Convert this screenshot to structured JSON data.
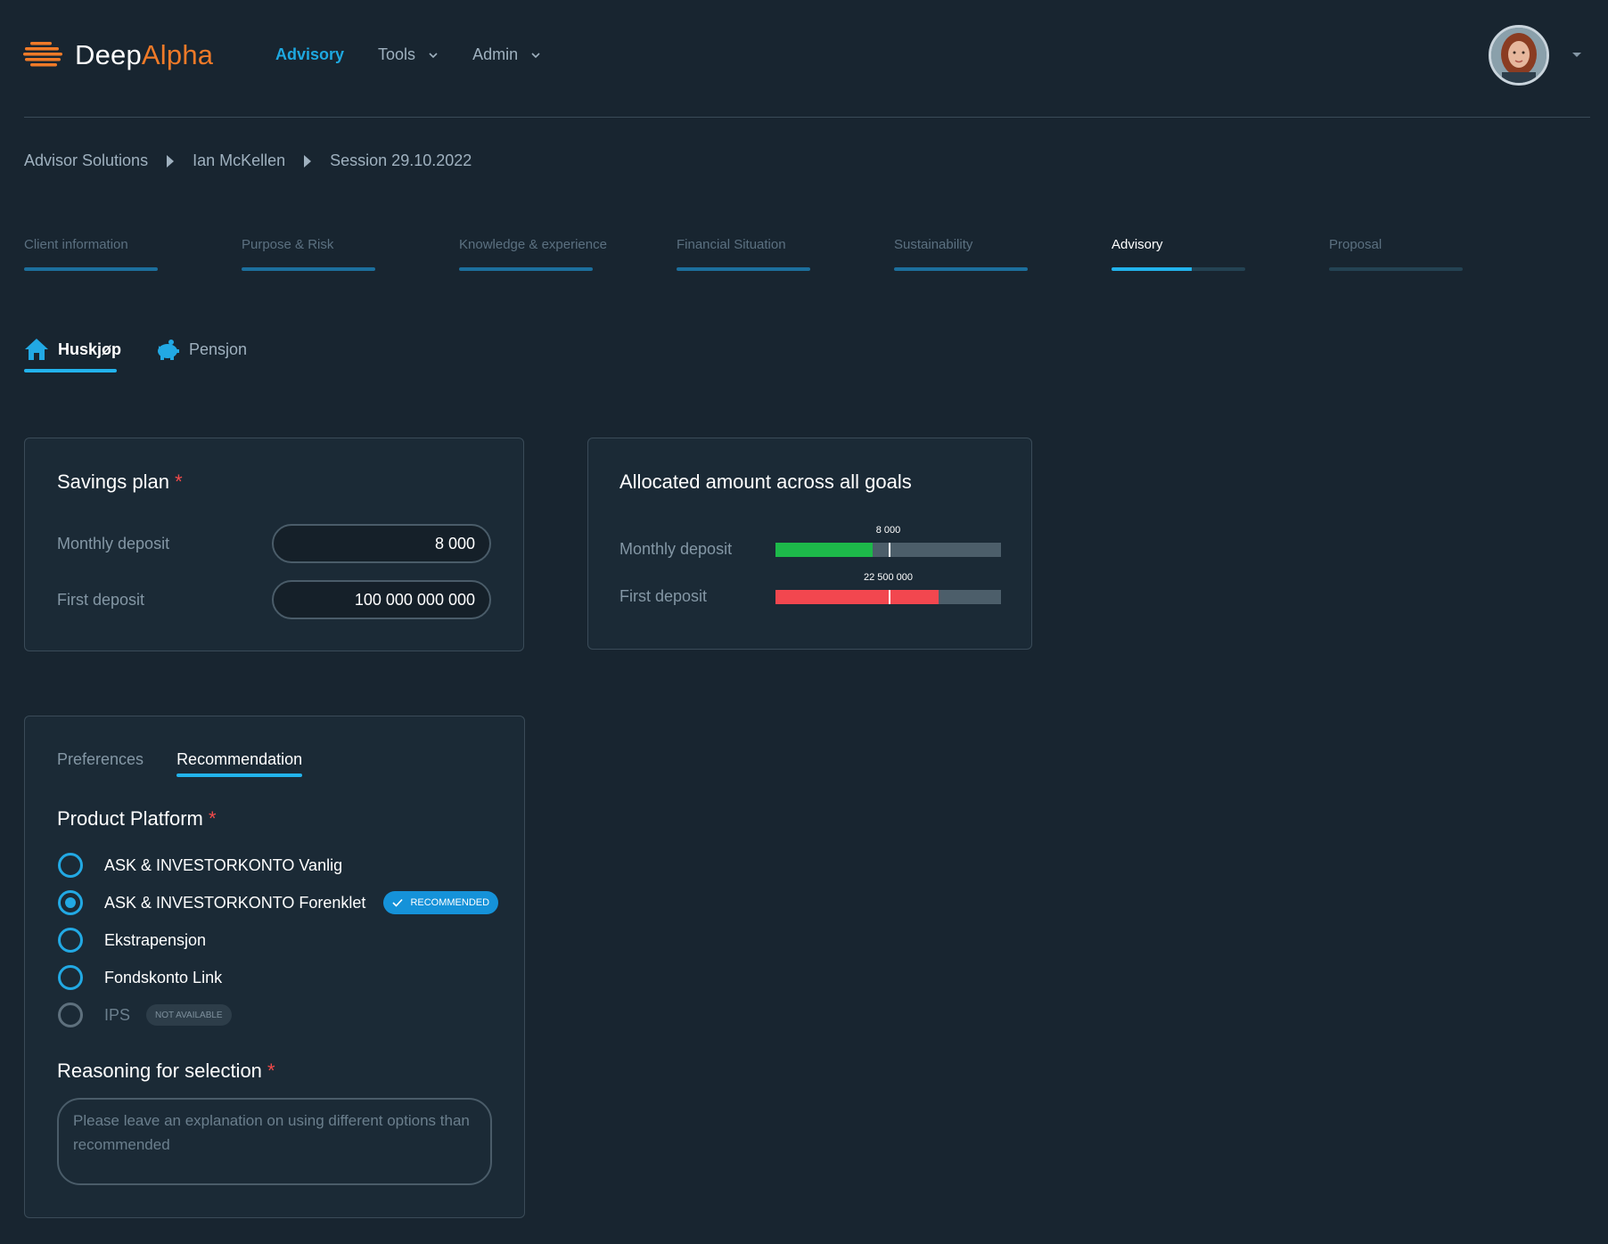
{
  "header": {
    "logo_part1": "Deep",
    "logo_part2": "Alpha",
    "nav": [
      {
        "label": "Advisory",
        "active": true
      },
      {
        "label": "Tools"
      },
      {
        "label": "Admin"
      }
    ]
  },
  "breadcrumb": [
    "Advisor Solutions",
    "Ian McKellen",
    "Session 29.10.2022"
  ],
  "steps": [
    {
      "label": "Client information",
      "progress": 1.0
    },
    {
      "label": "Purpose & Risk",
      "progress": 1.0
    },
    {
      "label": "Knowledge & experience",
      "progress": 1.0
    },
    {
      "label": "Financial Situation",
      "progress": 1.0
    },
    {
      "label": "Sustainability",
      "progress": 1.0
    },
    {
      "label": "Advisory",
      "progress": 0.6,
      "active": true
    },
    {
      "label": "Proposal",
      "progress": 0.0
    }
  ],
  "goal_tabs": [
    {
      "label": "Huskjøp",
      "icon": "house-icon",
      "active": true
    },
    {
      "label": "Pensjon",
      "icon": "piggy-bank-icon"
    }
  ],
  "savings_plan": {
    "title": "Savings plan",
    "required_mark": "*",
    "monthly_label": "Monthly deposit",
    "monthly_value": "8 000",
    "first_label": "First deposit",
    "first_value": "100 000 000 000"
  },
  "allocated": {
    "title": "Allocated amount across all goals",
    "rows": [
      {
        "label": "Monthly deposit",
        "value_label": "8 000",
        "fill_fraction": 0.43,
        "marker_fraction": 0.5,
        "color": "#1db94a"
      },
      {
        "label": "First deposit",
        "value_label": "22 500 000",
        "fill_fraction": 0.725,
        "marker_fraction": 0.5,
        "color": "#f2474f"
      }
    ]
  },
  "recommendation": {
    "tabs": [
      {
        "label": "Preferences"
      },
      {
        "label": "Recommendation",
        "active": true
      }
    ],
    "platform_title": "Product Platform",
    "required_mark": "*",
    "options": [
      {
        "label": "ASK & INVESTORKONTO Vanlig",
        "checked": false
      },
      {
        "label": "ASK & INVESTORKONTO Forenklet",
        "checked": true,
        "badge": "RECOMMENDED"
      },
      {
        "label": "Ekstrapensjon",
        "checked": false
      },
      {
        "label": "Fondskonto Link",
        "checked": false
      },
      {
        "label": "IPS",
        "checked": false,
        "disabled": true,
        "badge": "NOT AVAILABLE"
      }
    ],
    "reasoning_title": "Reasoning for selection",
    "reasoning_placeholder": "Please leave an explanation on using different options than recommended"
  },
  "colors": {
    "accent": "#22b3ec",
    "brand_orange": "#f07a28",
    "required": "#f24a4a",
    "background": "#182530"
  }
}
